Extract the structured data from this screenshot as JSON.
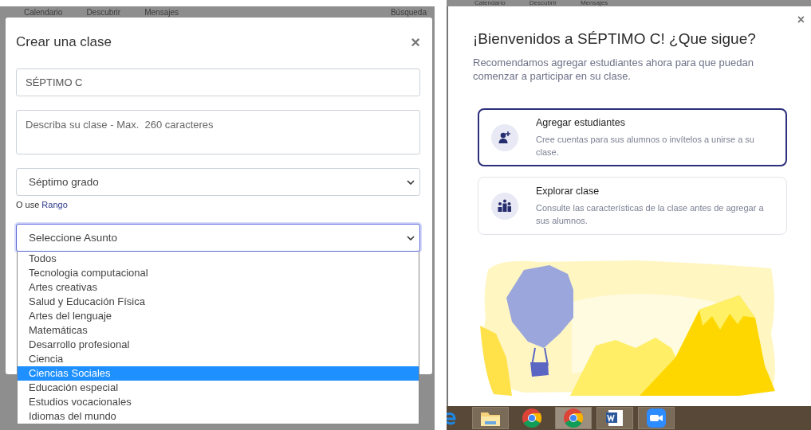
{
  "left": {
    "nav": [
      "Calendario",
      "Descubrir",
      "Mensajes",
      "Búsqueda"
    ],
    "dialog": {
      "title": "Crear una clase",
      "close": "×",
      "name_field": {
        "value": "SÉPTIMO C"
      },
      "description_field": {
        "placeholder": "Describa su clase - Max.  260 caracteres"
      },
      "grade_select": {
        "value": "Séptimo grado"
      },
      "range_hint": {
        "text": "O use",
        "link": "Rango"
      },
      "subject_select": {
        "value": "Seleccione Asunto",
        "options": [
          {
            "label": "Todos",
            "selected": false
          },
          {
            "label": "Tecnologia computacional",
            "selected": false
          },
          {
            "label": "Artes creativas",
            "selected": false
          },
          {
            "label": "Salud y Educación Física",
            "selected": false
          },
          {
            "label": "Artes del lenguaje",
            "selected": false
          },
          {
            "label": "Matemáticas",
            "selected": false
          },
          {
            "label": "Desarrollo profesional",
            "selected": false
          },
          {
            "label": "Ciencia",
            "selected": false
          },
          {
            "label": "Ciencias Sociales",
            "selected": true
          },
          {
            "label": "Educación especial",
            "selected": false
          },
          {
            "label": "Estudios vocacionales",
            "selected": false
          },
          {
            "label": "Idiomas del mundo",
            "selected": false
          }
        ]
      }
    }
  },
  "right": {
    "nav": [
      "Calendario",
      "Descubrir",
      "Mensajes"
    ],
    "dialog": {
      "close": "×",
      "title": "¡Bienvenidos a SÉPTIMO C! ¿Que sigue?",
      "subtitle": "Recomendamos agregar estudiantes ahora para que puedan comenzar a participar en su clase.",
      "options": [
        {
          "kind": "add_students",
          "title": "Agregar estudiantes",
          "description": "Cree cuentas para sus alumnos o invítelos a unirse a su clase.",
          "selected": true
        },
        {
          "kind": "explore",
          "title": "Explorar clase",
          "description": "Consulte las características de la clase antes de agregar a sus alumnos.",
          "selected": false
        }
      ]
    }
  }
}
